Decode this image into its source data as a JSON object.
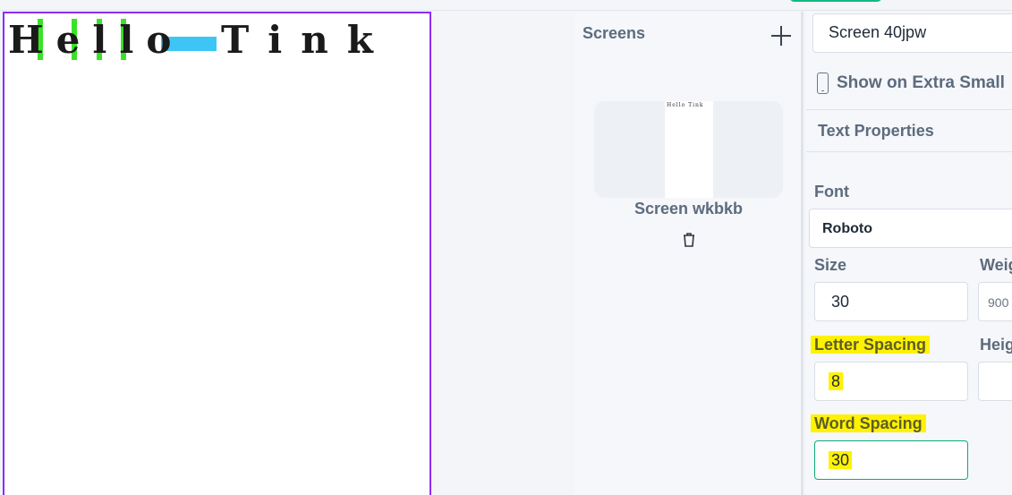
{
  "canvas": {
    "headline_word1": "Hello",
    "headline_word2": "Tink"
  },
  "screens_panel": {
    "title": "Screens",
    "thumb_text": "Hello  Tink",
    "screen_name": "Screen wkbkb"
  },
  "properties": {
    "screen_field_value": "Screen 40jpw",
    "device_label": "Show on Extra Small",
    "section_title": "Text Properties",
    "font_label": "Font",
    "font_value": "Roboto",
    "size_label": "Size",
    "size_value": "30",
    "weight_label": "Weig",
    "weight_value": "900",
    "letter_spacing_label": "Letter Spacing",
    "letter_spacing_value": "8",
    "height_label": "Heig",
    "word_spacing_label": "Word Spacing",
    "word_spacing_value": "30"
  },
  "colors": {
    "frame_border": "#8b2cf5",
    "highlight": "#fff200",
    "active_border": "#10a877",
    "letter_spacing_marker": "#22e010",
    "word_spacing_marker": "#3dc6f5"
  }
}
